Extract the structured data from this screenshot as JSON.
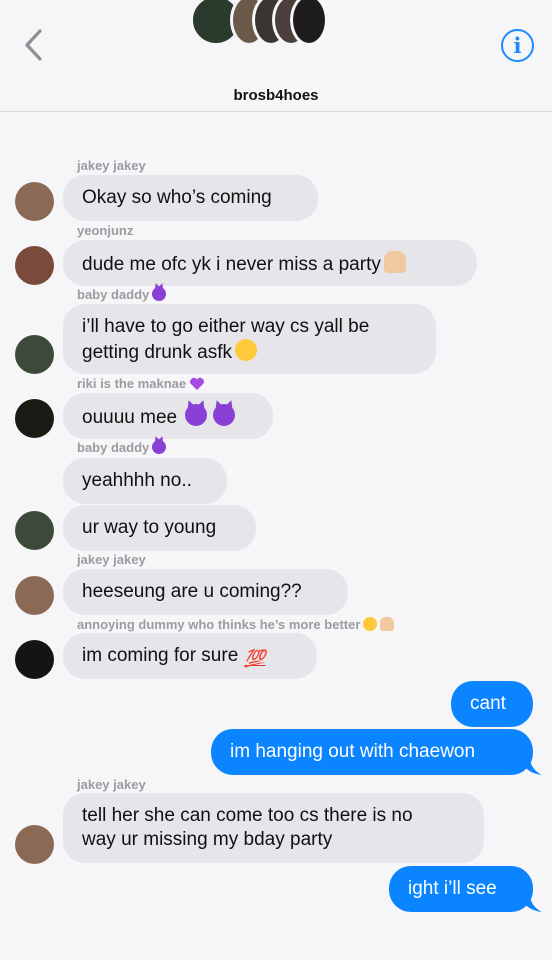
{
  "header": {
    "group_name": "brosb4hoes",
    "back_icon": "chevron-left-icon",
    "info_icon": "info-icon",
    "info_label": "i",
    "accent": "#1a8cff"
  },
  "messages": [
    {
      "sender": "jakey jakey",
      "text": "Okay so who’s coming"
    },
    {
      "sender": "yeonjunz",
      "text": "dude me ofc yk i never miss a party"
    },
    {
      "sender": "baby daddy",
      "text1": "i’ll have to go either way cs yall be",
      "text2": "getting drunk asfk"
    },
    {
      "sender": "riki is the maknae",
      "text": "ouuuu mee"
    },
    {
      "sender": "baby daddy",
      "text": "yeahhhh no.."
    },
    {
      "text": "ur way to young"
    },
    {
      "sender": "jakey jakey",
      "text": "heeseung are u coming??"
    },
    {
      "sender": "annoying dummy who thinks he’s more better",
      "text": "im coming for sure"
    },
    {
      "text": "cant"
    },
    {
      "text": "im hanging out with chaewon"
    },
    {
      "sender": "jakey jakey",
      "text1": "tell her she can come too cs there is no",
      "text2": "way ur missing my bday party"
    },
    {
      "text": "ight i’ll see"
    }
  ],
  "emoji_100": "💯",
  "colors": {
    "incoming": "#e5e5ea",
    "outgoing": "#0a84ff",
    "sender": "#9b9ba0"
  }
}
